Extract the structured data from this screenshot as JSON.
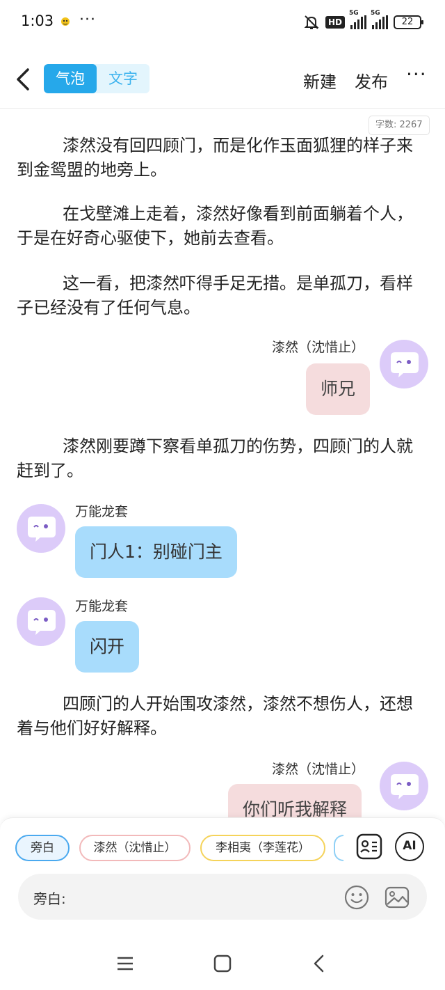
{
  "status_bar": {
    "time": "1:03",
    "more": "···",
    "hd": "HD",
    "net1": "5G",
    "net2": "5G",
    "battery": "22"
  },
  "nav": {
    "tabs": [
      {
        "label": "气泡",
        "active": true
      },
      {
        "label": "文字",
        "active": false
      }
    ],
    "new_label": "新建",
    "publish_label": "发布",
    "more_label": "···"
  },
  "word_count": "字数: 2267",
  "content": {
    "p1": "漆然没有回四顾门，而是化作玉面狐狸的样子来到金鸳盟的地旁上。",
    "p2": "在戈壁滩上走着，漆然好像看到前面躺着个人，于是在好奇心驱使下，她前去查看。",
    "p3": "这一看，把漆然吓得手足无措。是单孤刀，看样子已经没有了任何气息。",
    "msg1": {
      "speaker": "漆然（沈惜止）",
      "text": "师兄"
    },
    "p4": "漆然刚要蹲下察看单孤刀的伤势，四顾门的人就赶到了。",
    "msg2": {
      "speaker": "万能龙套",
      "text": "门人1：别碰门主"
    },
    "msg3": {
      "speaker": "万能龙套",
      "text": "闪开"
    },
    "p5": "四顾门的人开始围攻漆然，漆然不想伤人，还想着与他们好好解释。",
    "msg4": {
      "speaker": "漆然（沈惜止）",
      "text": "你们听我解释"
    }
  },
  "characters": [
    "旁白",
    "漆然（沈惜止）",
    "李相夷（李莲花）"
  ],
  "input": {
    "label": "旁白:",
    "value": ""
  },
  "tools": {
    "ai_label": "AI"
  },
  "colors": {
    "accent": "#26a8ea",
    "pink_bubble": "#f5dcdd",
    "blue_bubble": "#a8dcfc",
    "avatar": "#dccbf9"
  }
}
